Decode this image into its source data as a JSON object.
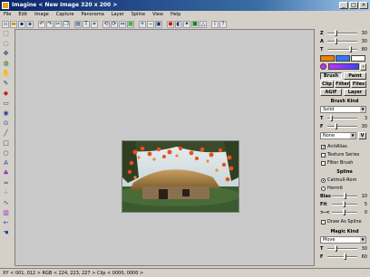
{
  "window": {
    "title": "Imagine < New Image 320 x 200 >",
    "controls": [
      "_",
      "□",
      "×"
    ]
  },
  "menu": [
    "File",
    "Edit",
    "Image",
    "Capture",
    "Panorama",
    "Layer",
    "Spline",
    "View",
    "Help"
  ],
  "toolbar_icons": [
    "new-icon",
    "open-icon",
    "save-icon",
    "brush-icon",
    "undo-icon",
    "redo-icon",
    "cut-icon",
    "copy-icon",
    "paste-icon",
    "text-icon",
    "crop-icon",
    "rotate-left-icon",
    "rotate-right-icon",
    "flip-icon",
    "layer-icon",
    "zoom-in-icon",
    "zoom-out-icon",
    "fit-icon",
    "palette-icon",
    "gradient-icon",
    "effect-icon",
    "color-icon",
    "sharpen-icon",
    "info-icon",
    "help-icon"
  ],
  "left_tools": [
    "select-icon",
    "lasso-icon",
    "move-icon",
    "zoom-icon",
    "hand-icon",
    "pencil-icon",
    "brush-icon",
    "eraser-icon",
    "fill-icon",
    "picker-icon",
    "line-icon",
    "rect-icon",
    "ellipse-icon",
    "text-icon",
    "stamp-icon",
    "blur-icon",
    "spray-icon",
    "warp-icon",
    "gradient-icon",
    "arrow-icon",
    "hand-icon"
  ],
  "panel": {
    "zat": [
      {
        "label": "Z",
        "value": "30",
        "level": 0.3
      },
      {
        "label": "A",
        "value": "30",
        "level": 0.3
      },
      {
        "label": "T",
        "value": "80",
        "level": 0.8
      }
    ],
    "colors": [
      "#f08000",
      "#3278ff",
      "#ffffff"
    ],
    "gradient_colors": [
      "#c830ff",
      "#4040ff"
    ],
    "buttons_row1": [
      "Brush",
      "Paint"
    ],
    "buttons_row2": [
      "Clip",
      "Filter",
      "Files"
    ],
    "buttons_row3": [
      "AGIF",
      "Layer"
    ],
    "brush_kind_title": "Brush Kind",
    "brush_kind_value": "Solid",
    "brush_t": {
      "label": "T",
      "value": "3",
      "level": 0.15
    },
    "brush_f": {
      "label": "F",
      "value": "30",
      "level": 0.3
    },
    "none_value": "None",
    "v_label": "V",
    "checks": [
      {
        "label": "AntiAlias",
        "checked": true
      },
      {
        "label": "Texture Series",
        "checked": false
      },
      {
        "label": "Filter Brush",
        "checked": false
      }
    ],
    "spline_title": "Spline",
    "spline_opts": [
      {
        "label": "Catmull-Rom",
        "checked": true
      },
      {
        "label": "Hermit",
        "checked": false
      }
    ],
    "spline_sliders": [
      {
        "label": "Bias",
        "value": "10",
        "level": 0.55
      },
      {
        "label": "Fit",
        "value": "5",
        "level": 0.5
      },
      {
        "label": ">-<",
        "value": "0",
        "level": 0.5
      }
    ],
    "draw_as_spline": "Draw As Spline",
    "magic_title": "Magic Kind",
    "magic_value": "Move",
    "magic_t": {
      "label": "T",
      "value": "30",
      "level": 0.3
    },
    "magic_f": {
      "label": "F",
      "value": "60",
      "level": 0.6
    }
  },
  "status": "XY < 001, 012 > RGB < 224, 223, 227 > Clip < 0000, 0000 >"
}
